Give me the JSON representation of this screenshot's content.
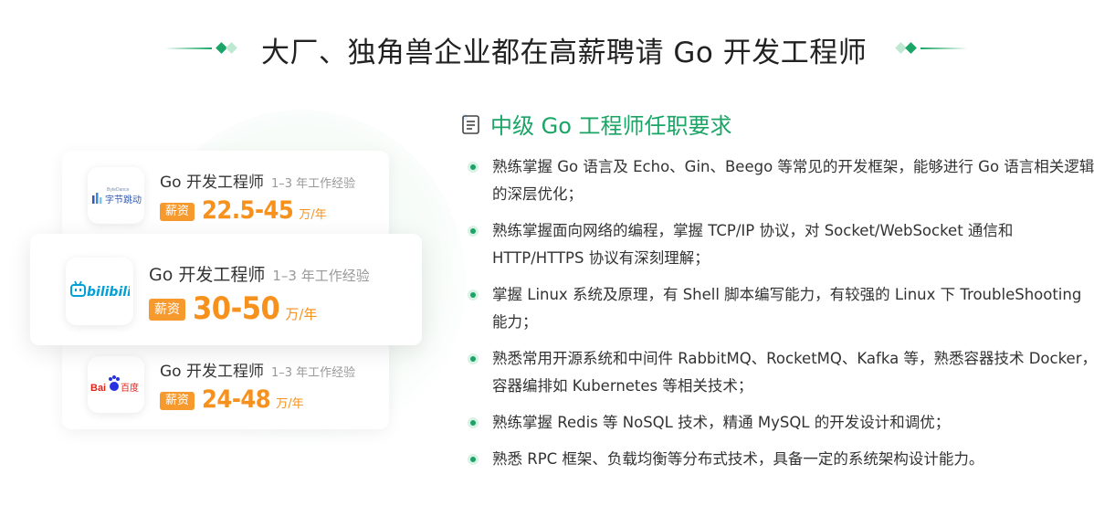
{
  "header": {
    "title": "大厂、独角兽企业都在高薪聘请 Go 开发工程师"
  },
  "cards": [
    {
      "company_logo_text": "字节跳动",
      "company_logo_small": "ByteDance",
      "job": "Go 开发工程师",
      "experience": "1–3 年工作经验",
      "badge": "薪资",
      "salary": "22.5-45",
      "unit": "万/年"
    },
    {
      "company_logo_text": "bilibili",
      "job": "Go 开发工程师",
      "experience": "1–3 年工作经验",
      "badge": "薪资",
      "salary": "30-50",
      "unit": "万/年"
    },
    {
      "company_logo_text": "百度",
      "company_logo_prefix": "Bai",
      "job": "Go 开发工程师",
      "experience": "1–3 年工作经验",
      "badge": "薪资",
      "salary": "24-48",
      "unit": "万/年"
    }
  ],
  "requirements": {
    "title": "中级 Go 工程师任职要求",
    "items": [
      "熟练掌握 Go 语言及 Echo、Gin、Beego 等常见的开发框架，能够进行 Go 语言相关逻辑的深层优化；",
      "熟练掌握面向网络的编程，掌握 TCP/IP 协议，对 Socket/WebSocket 通信和 HTTP/HTTPS 协议有深刻理解；",
      "掌握 Linux 系统及原理，有 Shell 脚本编写能力，有较强的 Linux 下 TroubleShooting 能力；",
      "熟悉常用开源系统和中间件 RabbitMQ、RocketMQ、Kafka 等，熟悉容器技术 Docker，容器编排如 Kubernetes 等相关技术；",
      "熟练掌握 Redis 等 NoSQL 技术，精通 MySQL 的开发设计和调优；",
      "熟悉 RPC 框架、负载均衡等分布式技术，具备一定的系统架构设计能力。"
    ]
  },
  "colors": {
    "accent_green": "#1aa566",
    "salary_orange": "#f7911e",
    "badge_orange": "#f79a2e",
    "bilibili_blue": "#00a1d6",
    "baidu_red": "#e1251b",
    "baidu_blue": "#2932e1",
    "bytedance_blue": "#325ab4"
  }
}
